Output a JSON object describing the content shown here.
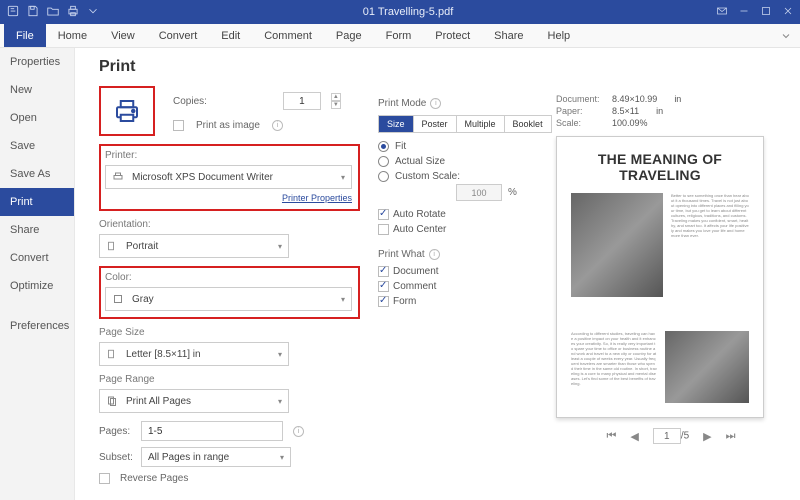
{
  "app": {
    "title": "01 Travelling-5.pdf"
  },
  "menubar": [
    "File",
    "Home",
    "View",
    "Convert",
    "Edit",
    "Comment",
    "Page",
    "Form",
    "Protect",
    "Share",
    "Help"
  ],
  "menubar_active": 0,
  "sidebar": [
    "Properties",
    "New",
    "Open",
    "Save",
    "Save As",
    "Print",
    "Share",
    "Convert",
    "Optimize",
    "Preferences"
  ],
  "sidebar_active": 5,
  "page": {
    "title": "Print",
    "copies_label": "Copies:",
    "copies_value": "1",
    "print_as_image": "Print as image",
    "printer_label": "Printer:",
    "printer_value": "Microsoft XPS Document Writer",
    "printer_properties": "Printer Properties",
    "orientation_label": "Orientation:",
    "orientation_value": "Portrait",
    "color_label": "Color:",
    "color_value": "Gray",
    "pagesize_label": "Page Size",
    "pagesize_value": "Letter [8.5×11] in",
    "pagerange_label": "Page Range",
    "pagerange_value": "Print All Pages",
    "pages_label": "Pages:",
    "pages_value": "1-5",
    "subset_label": "Subset:",
    "subset_value": "All Pages in range",
    "reverse_pages": "Reverse Pages"
  },
  "mid": {
    "print_mode_label": "Print Mode",
    "segments": [
      "Size",
      "Poster",
      "Multiple",
      "Booklet"
    ],
    "segment_active": 0,
    "radios": [
      "Fit",
      "Actual Size",
      "Custom Scale:"
    ],
    "radio_active": 0,
    "scale_value": "100",
    "scale_unit": "%",
    "auto_rotate": "Auto Rotate",
    "auto_center": "Auto Center",
    "print_what_label": "Print What",
    "print_what": [
      "Document",
      "Comment",
      "Form"
    ]
  },
  "right": {
    "document_label": "Document:",
    "document_value": "8.49×10.99",
    "unit": "in",
    "paper_label": "Paper:",
    "paper_value": "8.5×11",
    "scale_label": "Scale:",
    "scale_value": "100.09%",
    "preview_title": "THE MEANING OF TRAVELING",
    "nav_page": "1",
    "nav_total": "/5"
  }
}
